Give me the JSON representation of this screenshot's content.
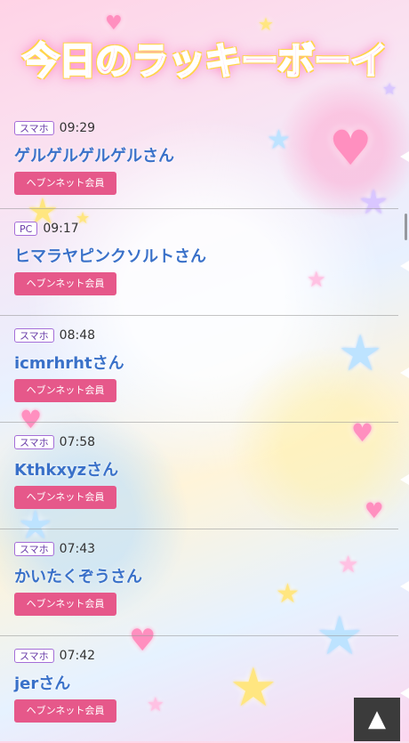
{
  "header": {
    "title": "今日のラッキーボーイ"
  },
  "entries": [
    {
      "device": "スマホ",
      "time": "09:29",
      "name": "ゲルゲルゲルゲルさん",
      "badge": "ヘブンネット会員"
    },
    {
      "device": "PC",
      "time": "09:17",
      "name": "ヒマラヤピンクソルトさん",
      "badge": "ヘブンネット会員"
    },
    {
      "device": "スマホ",
      "time": "08:48",
      "name": "icmrhrhtさん",
      "badge": "ヘブンネット会員"
    },
    {
      "device": "スマホ",
      "time": "07:58",
      "name": "Kthkxyzさん",
      "badge": "ヘブンネット会員"
    },
    {
      "device": "スマホ",
      "time": "07:43",
      "name": "かいたくぞうさん",
      "badge": "ヘブンネット会員"
    },
    {
      "device": "スマホ",
      "time": "07:42",
      "name": "jerさん",
      "badge": "ヘブンネット会員"
    }
  ],
  "scroll_top_icon": "▲",
  "colors": {
    "title": "#ff4fa5",
    "name": "#3a71c9",
    "badge_bg": "#e6588a",
    "device_border": "#a56ed8"
  }
}
